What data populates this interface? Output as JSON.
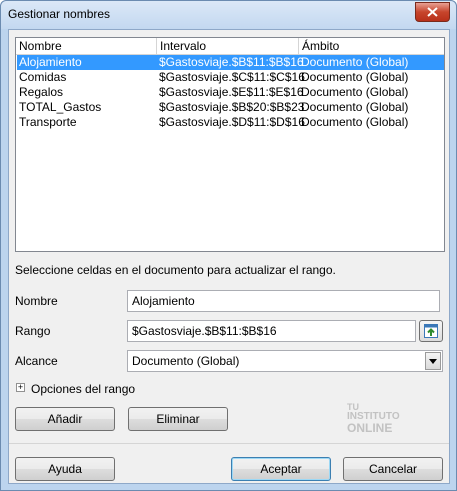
{
  "window": {
    "title": "Gestionar nombres"
  },
  "list": {
    "headers": {
      "name": "Nombre",
      "range": "Intervalo",
      "scope": "Ámbito"
    },
    "rows": [
      {
        "name": "Alojamiento",
        "range": "$Gastosviaje.$B$11:$B$16",
        "scope": "Documento (Global)"
      },
      {
        "name": "Comidas",
        "range": "$Gastosviaje.$C$11:$C$16",
        "scope": "Documento (Global)"
      },
      {
        "name": "Regalos",
        "range": "$Gastosviaje.$E$11:$E$16",
        "scope": "Documento (Global)"
      },
      {
        "name": "TOTAL_Gastos",
        "range": "$Gastosviaje.$B$20:$B$23",
        "scope": "Documento (Global)"
      },
      {
        "name": "Transporte",
        "range": "$Gastosviaje.$D$11:$D$16",
        "scope": "Documento (Global)"
      }
    ],
    "selected_index": 0
  },
  "hint": "Seleccione celdas en el documento para actualizar el rango.",
  "form": {
    "name_label": "Nombre",
    "name_value": "Alojamiento",
    "range_label": "Rango",
    "range_value": "$Gastosviaje.$B$11:$B$16",
    "scope_label": "Alcance",
    "scope_value": "Documento (Global)"
  },
  "options_label": "Opciones del rango",
  "buttons": {
    "add": "Añadir",
    "delete": "Eliminar",
    "help": "Ayuda",
    "ok": "Aceptar",
    "cancel": "Cancelar"
  },
  "watermark": {
    "line1": "TU",
    "line2": "INSTITUTO",
    "line3": "ONLINE"
  },
  "colors": {
    "selection": "#3399ff",
    "title_bar": "#c3d8f0",
    "close_button": "#c7452c"
  }
}
